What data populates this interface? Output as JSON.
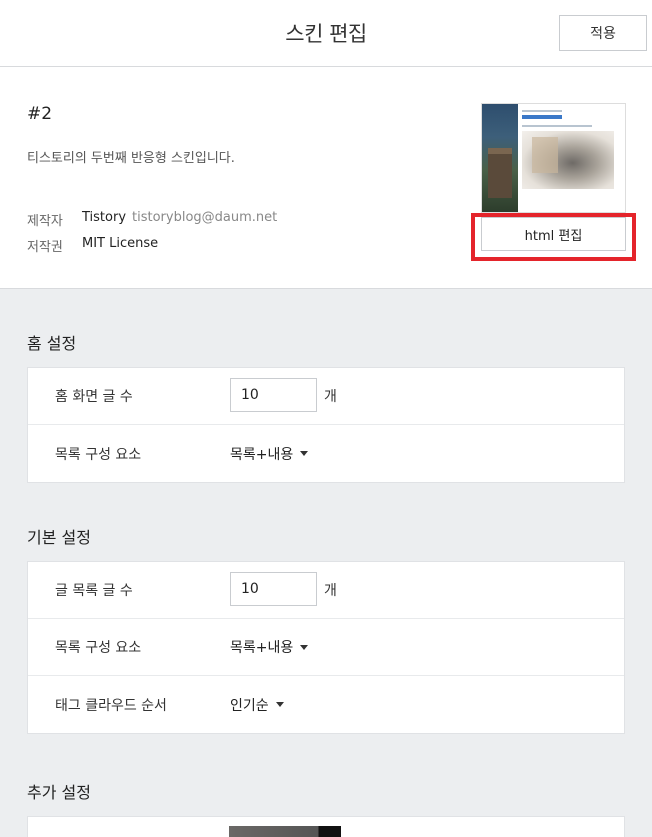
{
  "header": {
    "title": "스킨 편집",
    "apply_label": "적용"
  },
  "skin": {
    "name": "#2",
    "description": "티스토리의 두번째 반응형 스킨입니다.",
    "author_label": "제작자",
    "author": "Tistory",
    "author_email": "tistoryblog@daum.net",
    "license_label": "저작권",
    "license": "MIT License",
    "html_edit_label": "html 편집"
  },
  "home_settings": {
    "title": "홈 설정",
    "rows": [
      {
        "label": "홈 화면 글 수",
        "value": "10",
        "unit": "개"
      },
      {
        "label": "목록 구성 요소",
        "value": "목록+내용"
      }
    ]
  },
  "basic_settings": {
    "title": "기본 설정",
    "rows": [
      {
        "label": "글 목록 글 수",
        "value": "10",
        "unit": "개"
      },
      {
        "label": "목록 구성 요소",
        "value": "목록+내용"
      },
      {
        "label": "태그 클라우드 순서",
        "value": "인기순"
      }
    ]
  },
  "extra_settings": {
    "title": "추가 설정"
  },
  "colors": {
    "highlight": "#e4242b"
  }
}
